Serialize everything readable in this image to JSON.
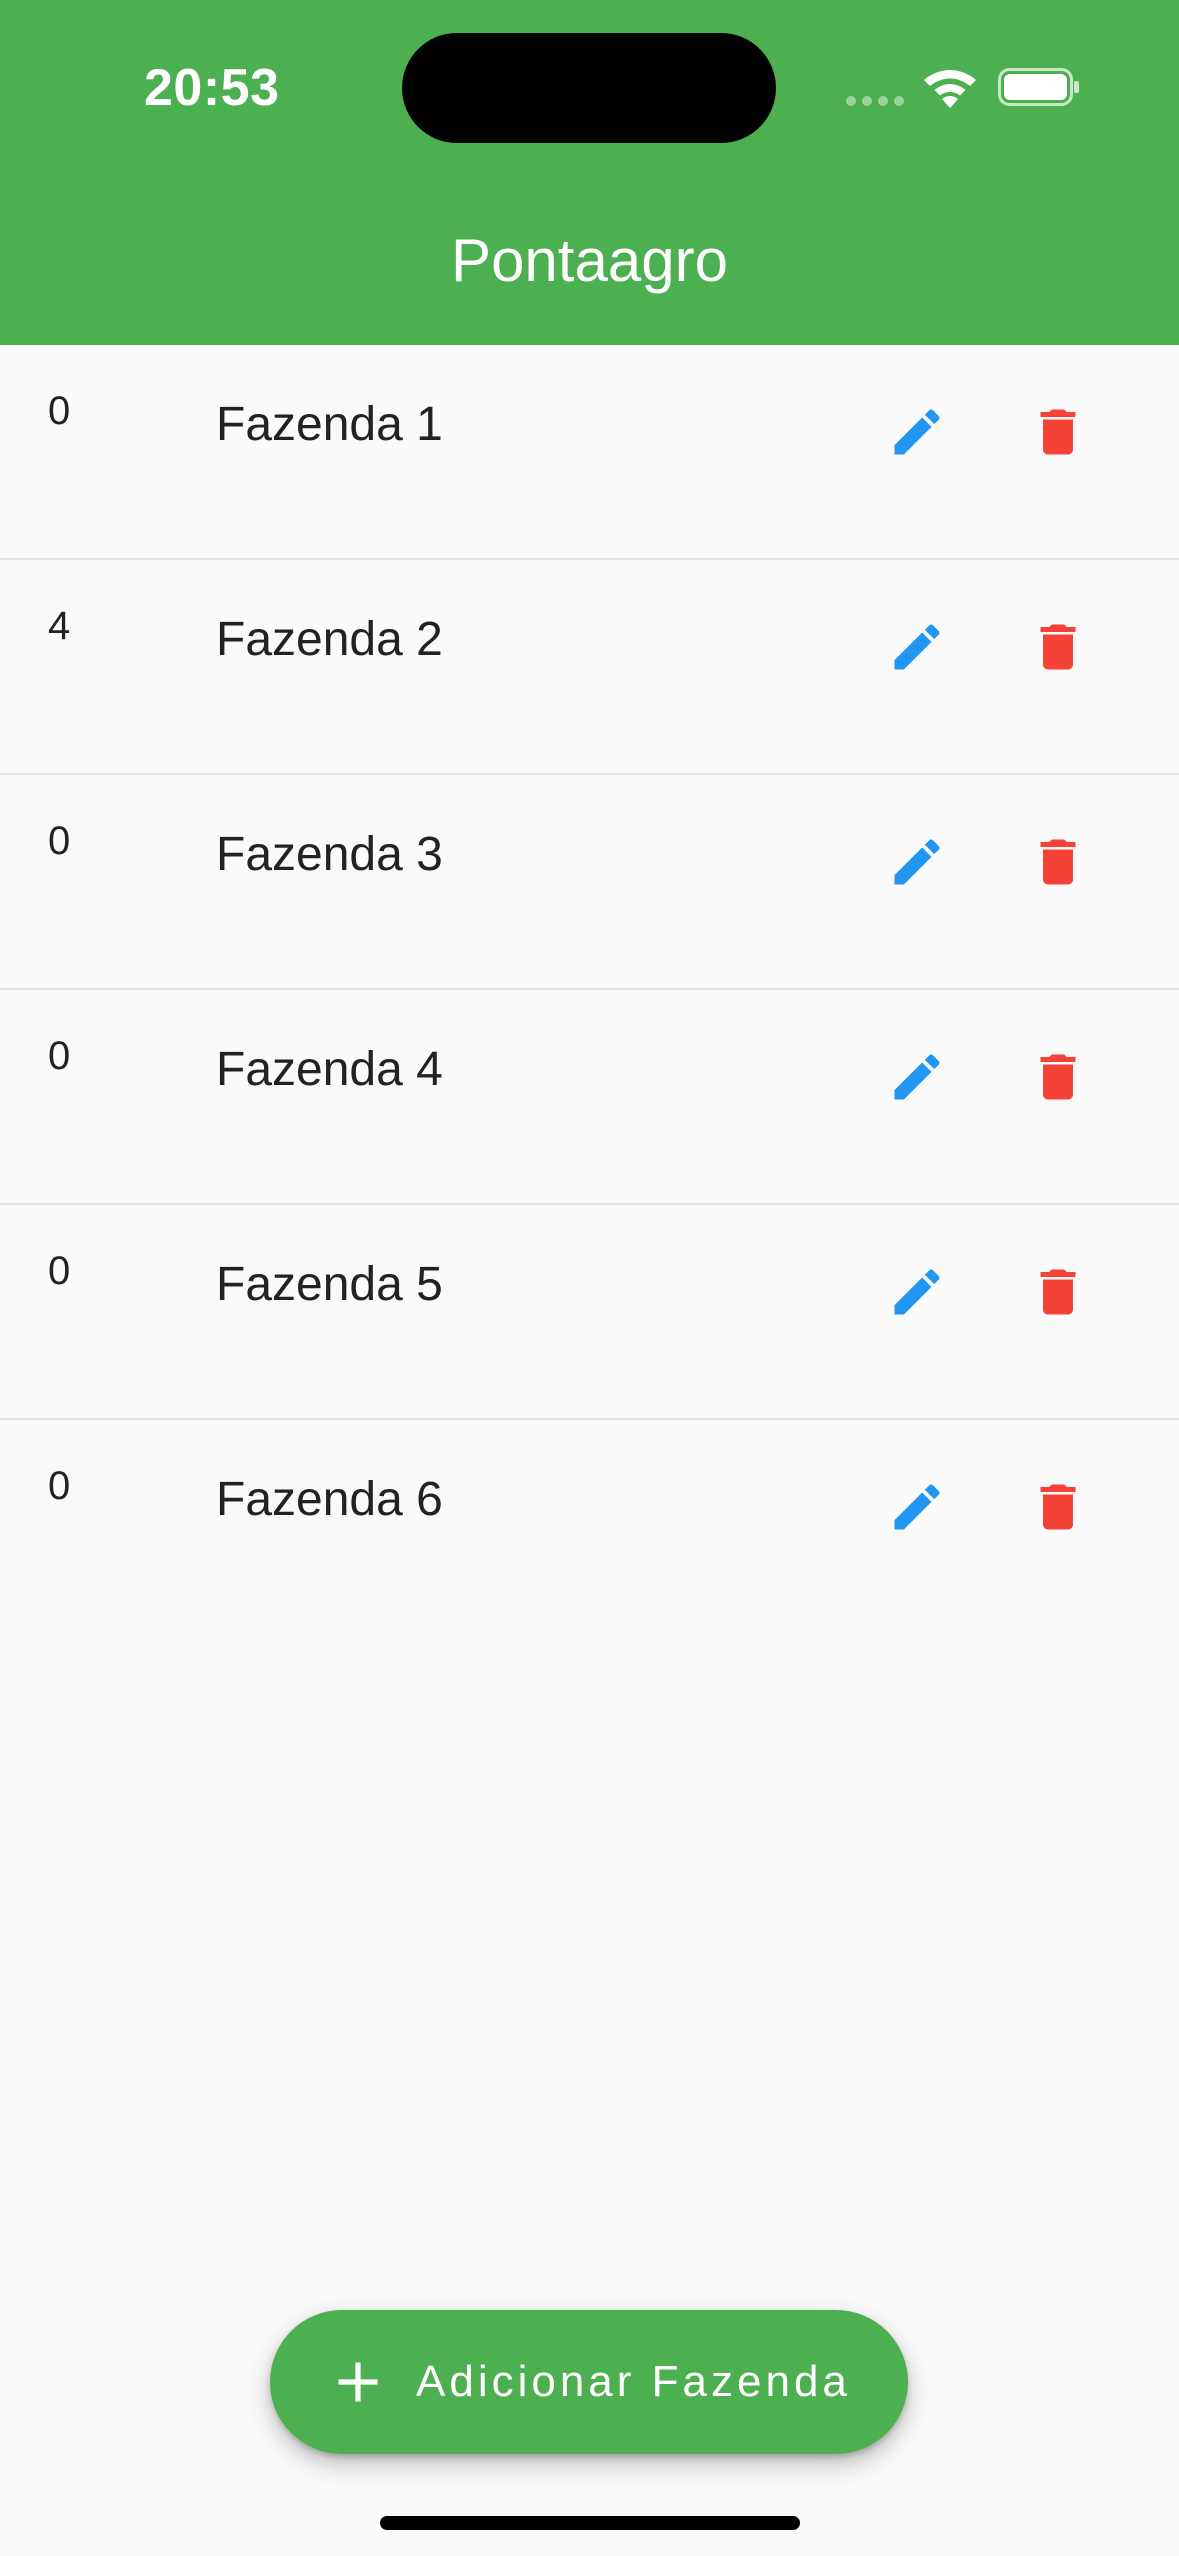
{
  "status_bar": {
    "time": "20:53"
  },
  "app_bar": {
    "title": "Pontaagro",
    "color": "#4CAF50"
  },
  "farms": [
    {
      "count": "0",
      "name": "Fazenda 1"
    },
    {
      "count": "4",
      "name": "Fazenda 2"
    },
    {
      "count": "0",
      "name": "Fazenda 3"
    },
    {
      "count": "0",
      "name": "Fazenda 4"
    },
    {
      "count": "0",
      "name": "Fazenda 5"
    },
    {
      "count": "0",
      "name": "Fazenda 6"
    }
  ],
  "icons": {
    "edit": "pencil-icon",
    "delete": "trash-icon",
    "add": "plus-icon",
    "edit_color": "#2196F3",
    "delete_color": "#F44336"
  },
  "fab": {
    "label": "Adicionar Fazenda"
  }
}
